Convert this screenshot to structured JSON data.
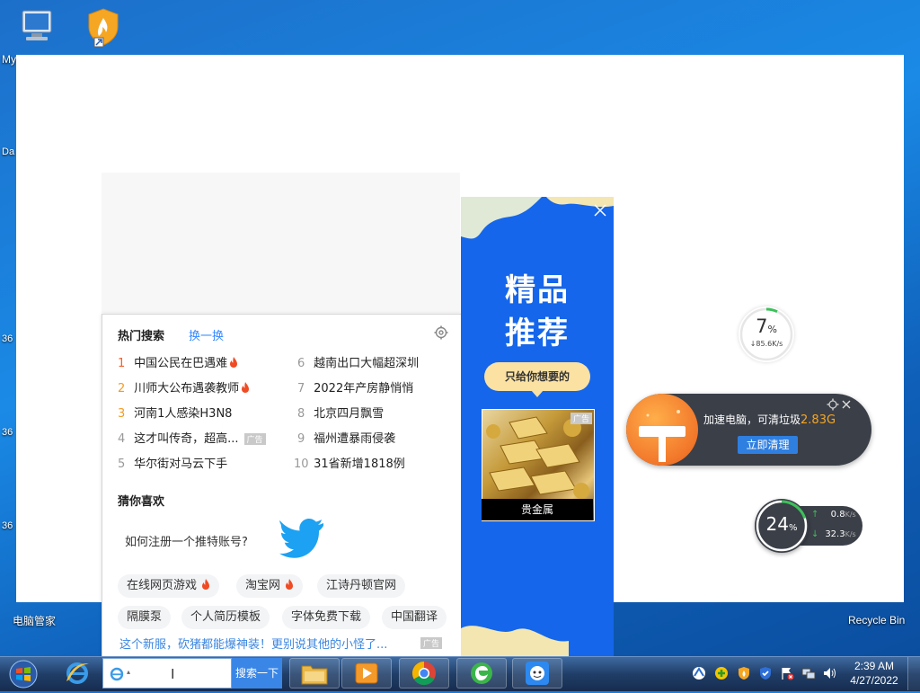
{
  "desktop": {
    "icons": [
      {
        "label": "My",
        "icon": "computer-icon"
      },
      {
        "label": "",
        "icon": "shield-flame-icon"
      },
      {
        "label": "电脑管家",
        "icon": "pc-manager-icon"
      },
      {
        "label": "Recycle Bin",
        "icon": "recycle-bin-icon"
      }
    ],
    "side_fragments": [
      "Da",
      "36",
      "36",
      "36"
    ]
  },
  "hot_search": {
    "title": "热门搜索",
    "refresh_label": "换一换",
    "items": [
      {
        "rank": "1",
        "text": "中国公民在巴遇难",
        "hot": true,
        "ad": false
      },
      {
        "rank": "2",
        "text": "川师大公布遇袭教师",
        "hot": true,
        "ad": false
      },
      {
        "rank": "3",
        "text": "河南1人感染H3N8",
        "hot": false,
        "ad": false
      },
      {
        "rank": "4",
        "text": "这才叫传奇，超高...",
        "hot": false,
        "ad": true
      },
      {
        "rank": "5",
        "text": "华尔街对马云下手",
        "hot": false,
        "ad": false
      },
      {
        "rank": "6",
        "text": "越南出口大幅超深圳",
        "hot": false,
        "ad": false
      },
      {
        "rank": "7",
        "text": "2022年产房静悄悄",
        "hot": false,
        "ad": false
      },
      {
        "rank": "8",
        "text": "北京四月飘雪",
        "hot": false,
        "ad": false
      },
      {
        "rank": "9",
        "text": "福州遭暴雨侵袭",
        "hot": false,
        "ad": false
      },
      {
        "rank": "10",
        "text": "31省新增1818例",
        "hot": false,
        "ad": false
      }
    ],
    "ad_label": "广告"
  },
  "guess": {
    "title": "猜你喜欢",
    "question": "如何注册一个推特账号?",
    "tags_row1": [
      {
        "text": "在线网页游戏",
        "hot": true
      },
      {
        "text": "淘宝网",
        "hot": true
      },
      {
        "text": "江诗丹顿官网",
        "hot": false
      }
    ],
    "tags_row2": [
      {
        "text": "隔膜泵",
        "hot": false
      },
      {
        "text": "个人简历模板",
        "hot": false
      },
      {
        "text": "字体免费下载",
        "hot": false
      },
      {
        "text": "中国翻译",
        "hot": false
      }
    ],
    "bottom_link": "这个新服，砍猪都能爆神装！更别说其他的小怪了...",
    "bottom_ad": "广告"
  },
  "ad_banner": {
    "headline_1": "精品",
    "headline_2": "推荐",
    "bubble": "只给你想要的",
    "photo_label": "贵金属",
    "photo_tag": "广告"
  },
  "widgets": {
    "speed_percent": "7",
    "speed_unit": "%",
    "speed_rate": "↓85.6K/s",
    "clean_text": "加速电脑，可清垃圾",
    "clean_amount": "2.83G",
    "clean_button": "立即清理",
    "net_percent": "24",
    "net_unit": "%",
    "net_up": "0.8",
    "net_down": "32.3",
    "net_rate_unit": "K/s"
  },
  "taskbar": {
    "search_button": "搜索一下",
    "time": "2:39 AM",
    "date": "4/27/2022"
  },
  "colors": {
    "accent_blue": "#3388ff",
    "hot_red": "#f25f2a",
    "ad_blue": "#1566ea",
    "clean_orange": "#f2772a"
  }
}
